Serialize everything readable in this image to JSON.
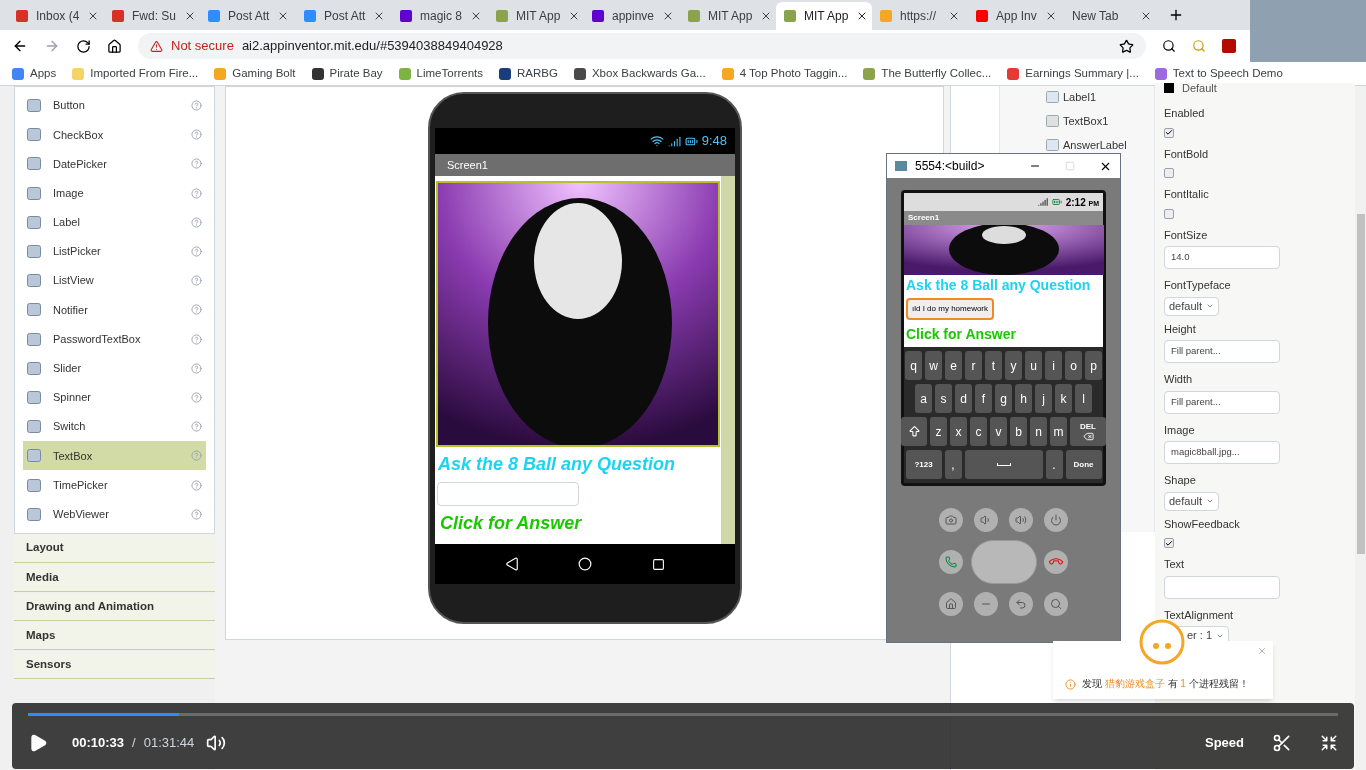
{
  "browser": {
    "tabs": [
      {
        "title": "Inbox (4",
        "color": "#d93025",
        "selected": false
      },
      {
        "title": "Fwd: Su",
        "color": "#d93025",
        "selected": false
      },
      {
        "title": "Post Att",
        "color": "#2d8cff",
        "selected": false
      },
      {
        "title": "Post Att",
        "color": "#2d8cff",
        "selected": false
      },
      {
        "title": "magic 8",
        "color": "#6001d2",
        "selected": false
      },
      {
        "title": "MIT App",
        "color": "#8ba34a",
        "selected": false
      },
      {
        "title": "appinve",
        "color": "#6001d2",
        "selected": false
      },
      {
        "title": "MIT App",
        "color": "#8ba34a",
        "selected": false
      },
      {
        "title": "MIT App",
        "color": "#8ba34a",
        "selected": true
      },
      {
        "title": "https://",
        "color": "#f5a623",
        "selected": false
      },
      {
        "title": "App Inv",
        "color": "#ff0000",
        "selected": false
      },
      {
        "title": "New Tab",
        "selected": false
      }
    ],
    "address": {
      "security": "Not secure",
      "url": "ai2.appinventor.mit.edu/#5394038849404928"
    },
    "bookmarks": [
      {
        "title": "Apps",
        "color": "#4285f4"
      },
      {
        "title": "Imported From Fire...",
        "color": "#f6d365"
      },
      {
        "title": "Gaming Bolt",
        "color": "#f5a623"
      },
      {
        "title": "Pirate Bay",
        "color": "#333333"
      },
      {
        "title": "LimeTorrents",
        "color": "#7cb342"
      },
      {
        "title": "RARBG",
        "color": "#1a3d7c"
      },
      {
        "title": "Xbox Backwards Ga...",
        "color": "#4a4a4a"
      },
      {
        "title": "4 Top Photo Taggin...",
        "color": "#f5a623"
      },
      {
        "title": "The Butterfly Collec...",
        "color": "#8ba34a"
      },
      {
        "title": "Earnings Summary |...",
        "color": "#e53935"
      },
      {
        "title": "Text to Speech Demo",
        "color": "#9c6ade"
      }
    ]
  },
  "palette": {
    "items": [
      {
        "label": "Button",
        "selected": false
      },
      {
        "label": "CheckBox",
        "selected": false
      },
      {
        "label": "DatePicker",
        "selected": false
      },
      {
        "label": "Image",
        "selected": false
      },
      {
        "label": "Label",
        "selected": false
      },
      {
        "label": "ListPicker",
        "selected": false
      },
      {
        "label": "ListView",
        "selected": false
      },
      {
        "label": "Notifier",
        "selected": false
      },
      {
        "label": "PasswordTextBox",
        "selected": false
      },
      {
        "label": "Slider",
        "selected": false
      },
      {
        "label": "Spinner",
        "selected": false
      },
      {
        "label": "Switch",
        "selected": false
      },
      {
        "label": "TextBox",
        "selected": true
      },
      {
        "label": "TimePicker",
        "selected": false
      },
      {
        "label": "WebViewer",
        "selected": false
      }
    ],
    "categories": [
      "Layout",
      "Media",
      "Drawing and Animation",
      "Maps",
      "Sensors"
    ]
  },
  "designer": {
    "time": "9:48",
    "screen_title": "Screen1",
    "question_label": "Ask the 8 Ball any Question",
    "answer_label": "Click for Answer"
  },
  "components": [
    {
      "name": "Label1",
      "kind": "label"
    },
    {
      "name": "TextBox1",
      "kind": "textbox"
    },
    {
      "name": "AnswerLabel",
      "kind": "label"
    }
  ],
  "properties": [
    {
      "kind": "color",
      "value": "Default"
    },
    {
      "kind": "checkbox",
      "label": "Enabled",
      "checked": true
    },
    {
      "kind": "checkbox",
      "label": "FontBold",
      "checked": false
    },
    {
      "kind": "checkbox",
      "label": "FontItalic",
      "checked": false
    },
    {
      "kind": "text",
      "label": "FontSize",
      "value": "14.0"
    },
    {
      "kind": "select",
      "label": "FontTypeface",
      "value": "default"
    },
    {
      "kind": "text",
      "label": "Height",
      "value": "Fill parent..."
    },
    {
      "kind": "text",
      "label": "Width",
      "value": "Fill parent..."
    },
    {
      "kind": "text",
      "label": "Image",
      "value": "magic8ball.jpg..."
    },
    {
      "kind": "select",
      "label": "Shape",
      "value": "default"
    },
    {
      "kind": "checkbox",
      "label": "ShowFeedback",
      "checked": true
    },
    {
      "kind": "text",
      "label": "Text"
    },
    {
      "kind": "select",
      "label": "TextAlignment",
      "value": "er : 1"
    }
  ],
  "emulator": {
    "title": "5554:<build>",
    "time": "2:12",
    "time_suffix": "PM",
    "screen_title": "Screen1",
    "question_label": "Ask the 8 Ball any Question",
    "textbox_value": "ıld I do my homework",
    "answer_label": "Click for Answer",
    "keyboard": [
      [
        {
          "kind": "letter",
          "label": "q"
        },
        {
          "kind": "letter",
          "label": "w"
        },
        {
          "kind": "letter",
          "label": "e"
        },
        {
          "kind": "letter",
          "label": "r"
        },
        {
          "kind": "letter",
          "label": "t"
        },
        {
          "kind": "letter",
          "label": "y"
        },
        {
          "kind": "letter",
          "label": "u"
        },
        {
          "kind": "letter",
          "label": "i"
        },
        {
          "kind": "letter",
          "label": "o"
        },
        {
          "kind": "letter",
          "label": "p"
        }
      ],
      [
        {
          "kind": "letter",
          "label": "a"
        },
        {
          "kind": "letter",
          "label": "s"
        },
        {
          "kind": "letter",
          "label": "d"
        },
        {
          "kind": "letter",
          "label": "f"
        },
        {
          "kind": "letter",
          "label": "g"
        },
        {
          "kind": "letter",
          "label": "h"
        },
        {
          "kind": "letter",
          "label": "j"
        },
        {
          "kind": "letter",
          "label": "k"
        },
        {
          "kind": "letter",
          "label": "l"
        }
      ],
      [
        {
          "kind": "shift"
        },
        {
          "kind": "letter",
          "label": "z"
        },
        {
          "kind": "letter",
          "label": "x"
        },
        {
          "kind": "letter",
          "label": "c"
        },
        {
          "kind": "letter",
          "label": "v"
        },
        {
          "kind": "letter",
          "label": "b"
        },
        {
          "kind": "letter",
          "label": "n"
        },
        {
          "kind": "letter",
          "label": "m"
        },
        {
          "kind": "del",
          "label": "DEL"
        }
      ],
      [
        {
          "kind": "wide",
          "label": "?123"
        },
        {
          "kind": "letter",
          "label": ","
        },
        {
          "kind": "space"
        },
        {
          "kind": "letter",
          "label": "."
        },
        {
          "kind": "wide",
          "label": "Done"
        }
      ]
    ]
  },
  "notification": {
    "parts": [
      {
        "text": "发现 ",
        "highlight": false
      },
      {
        "text": "猎豹游戏盒子",
        "highlight": true
      },
      {
        "text": " 有 ",
        "highlight": false
      },
      {
        "text": "1",
        "highlight": true
      },
      {
        "text": " 个进程残留！",
        "highlight": false
      }
    ]
  },
  "video": {
    "current": "00:10:33",
    "separator": "/",
    "duration": "01:31:44",
    "level": 0.115,
    "speed": "Speed"
  }
}
